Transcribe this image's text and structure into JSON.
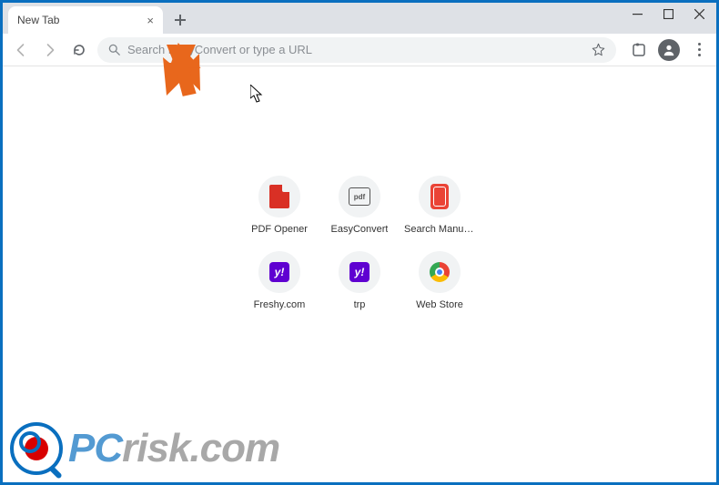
{
  "tab": {
    "title": "New Tab"
  },
  "omnibox": {
    "placeholder": "Search EasyConvert or type a URL"
  },
  "shortcuts": [
    {
      "label": "PDF Opener",
      "icon": "pdf"
    },
    {
      "label": "EasyConvert",
      "icon": "ec"
    },
    {
      "label": "Search Manua...",
      "icon": "sm"
    },
    {
      "label": "Freshy.com",
      "icon": "y"
    },
    {
      "label": "trp",
      "icon": "y"
    },
    {
      "label": "Web Store",
      "icon": "ws"
    }
  ],
  "watermark": {
    "text_pc": "PC",
    "text_rest": "risk.com"
  }
}
